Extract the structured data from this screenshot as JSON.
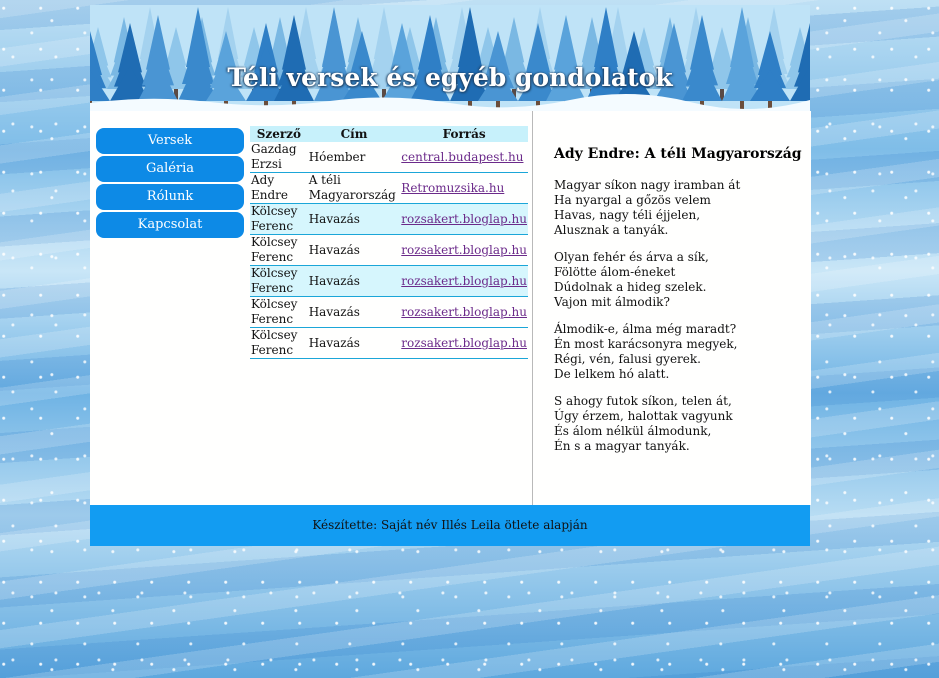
{
  "site": {
    "title": "Téli versek és egyéb gondolatok"
  },
  "nav": {
    "items": [
      {
        "label": "Versek"
      },
      {
        "label": "Galéria"
      },
      {
        "label": "Rólunk"
      },
      {
        "label": "Kapcsolat"
      }
    ]
  },
  "table": {
    "headers": {
      "author": "Szerző",
      "title": "Cím",
      "source": "Forrás"
    },
    "rows": [
      {
        "author": "Gazdag Erzsi",
        "title": "Hóember",
        "source": "central.budapest.hu"
      },
      {
        "author": "Ady Endre",
        "title": "A téli Magyarország",
        "source": "Retromuzsika.hu"
      },
      {
        "author": "Kölcsey Ferenc",
        "title": "Havazás",
        "source": "rozsakert.bloglap.hu"
      },
      {
        "author": "Kölcsey Ferenc",
        "title": "Havazás",
        "source": "rozsakert.bloglap.hu"
      },
      {
        "author": "Kölcsey Ferenc",
        "title": "Havazás",
        "source": "rozsakert.bloglap.hu"
      },
      {
        "author": "Kölcsey Ferenc",
        "title": "Havazás",
        "source": "rozsakert.bloglap.hu"
      },
      {
        "author": "Kölcsey Ferenc",
        "title": "Havazás",
        "source": "rozsakert.bloglap.hu"
      }
    ]
  },
  "poem": {
    "title": "Ady Endre: A téli Magyarország",
    "stanzas": [
      [
        "Magyar síkon nagy iramban át",
        "Ha nyargal a gőzös velem",
        "Havas, nagy téli éjjelen,",
        "Alusznak a tanyák."
      ],
      [
        "Olyan fehér és árva a sík,",
        "Fölötte álom-éneket",
        "Dúdolnak a hideg szelek.",
        "Vajon mit álmodik?"
      ],
      [
        "Álmodik-e, álma még maradt?",
        "Én most karácsonyra megyek,",
        "Régi, vén, falusi gyerek.",
        "De lelkem hó alatt."
      ],
      [
        "S ahogy futok síkon, telen át,",
        "Úgy érzem, halottak vagyunk",
        "És álom nélkül álmodunk,",
        "Én s a magyar tanyák."
      ]
    ]
  },
  "footer": {
    "text": "Készítette: Saját név Illés Leila ötlete alapján"
  },
  "colors": {
    "nav_button": "#0d8ae6",
    "footer": "#129cf2",
    "table_header": "#c7f1fb",
    "link": "#6b2a8a"
  }
}
